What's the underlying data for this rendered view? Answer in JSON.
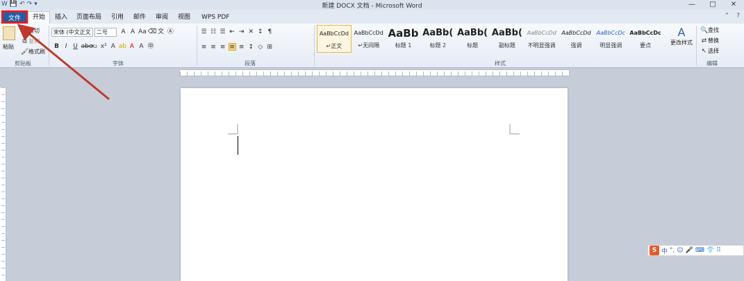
{
  "window": {
    "title": "新建 DOCX 文档 - Microsoft Word",
    "controls": [
      "—",
      "□",
      "✕"
    ]
  },
  "quick_access": [
    "W",
    "💾",
    "↶",
    "↷",
    "▾"
  ],
  "ribbon": {
    "file_tab": "文件",
    "tabs": [
      "开始",
      "插入",
      "页面布局",
      "引用",
      "邮件",
      "审阅",
      "视图",
      "WPS PDF"
    ],
    "clipboard": {
      "paste": "粘贴",
      "cut": "剪切",
      "copy": "复制",
      "format_painter": "格式刷",
      "label": "剪贴板"
    },
    "font": {
      "name": "宋体 (中文正文",
      "size": "二号",
      "label": "字体"
    },
    "paragraph": {
      "label": "段落"
    },
    "styles": {
      "label": "样式",
      "items": [
        {
          "sample": "AaBbCcDd",
          "name": "↵正文"
        },
        {
          "sample": "AaBbCcDd",
          "name": "↵无间隔"
        },
        {
          "sample": "AaBb",
          "name": "标题 1"
        },
        {
          "sample": "AaBb(",
          "name": "标题 2"
        },
        {
          "sample": "AaBb(",
          "name": "标题"
        },
        {
          "sample": "AaBb(",
          "name": "副标题"
        },
        {
          "sample": "AaBbCcDd",
          "name": "不明显强调"
        },
        {
          "sample": "AaBbCcDd",
          "name": "强调"
        },
        {
          "sample": "AaBbCcDc",
          "name": "明显强调"
        },
        {
          "sample": "AaBbCcDc",
          "name": "要点"
        }
      ],
      "change_styles": "更改样式"
    },
    "editing": {
      "find": "查找",
      "replace": "替换",
      "select": "选择",
      "label": "编辑"
    }
  },
  "ime": {
    "logo": "S",
    "items": [
      "中",
      "°,",
      "☺",
      "🎤",
      "⌨",
      "👕",
      "⠿"
    ]
  },
  "colors": {
    "file_tab_bg": "#1f5ea8",
    "highlight_box": "#e02020",
    "arrow": "#c0392b"
  }
}
